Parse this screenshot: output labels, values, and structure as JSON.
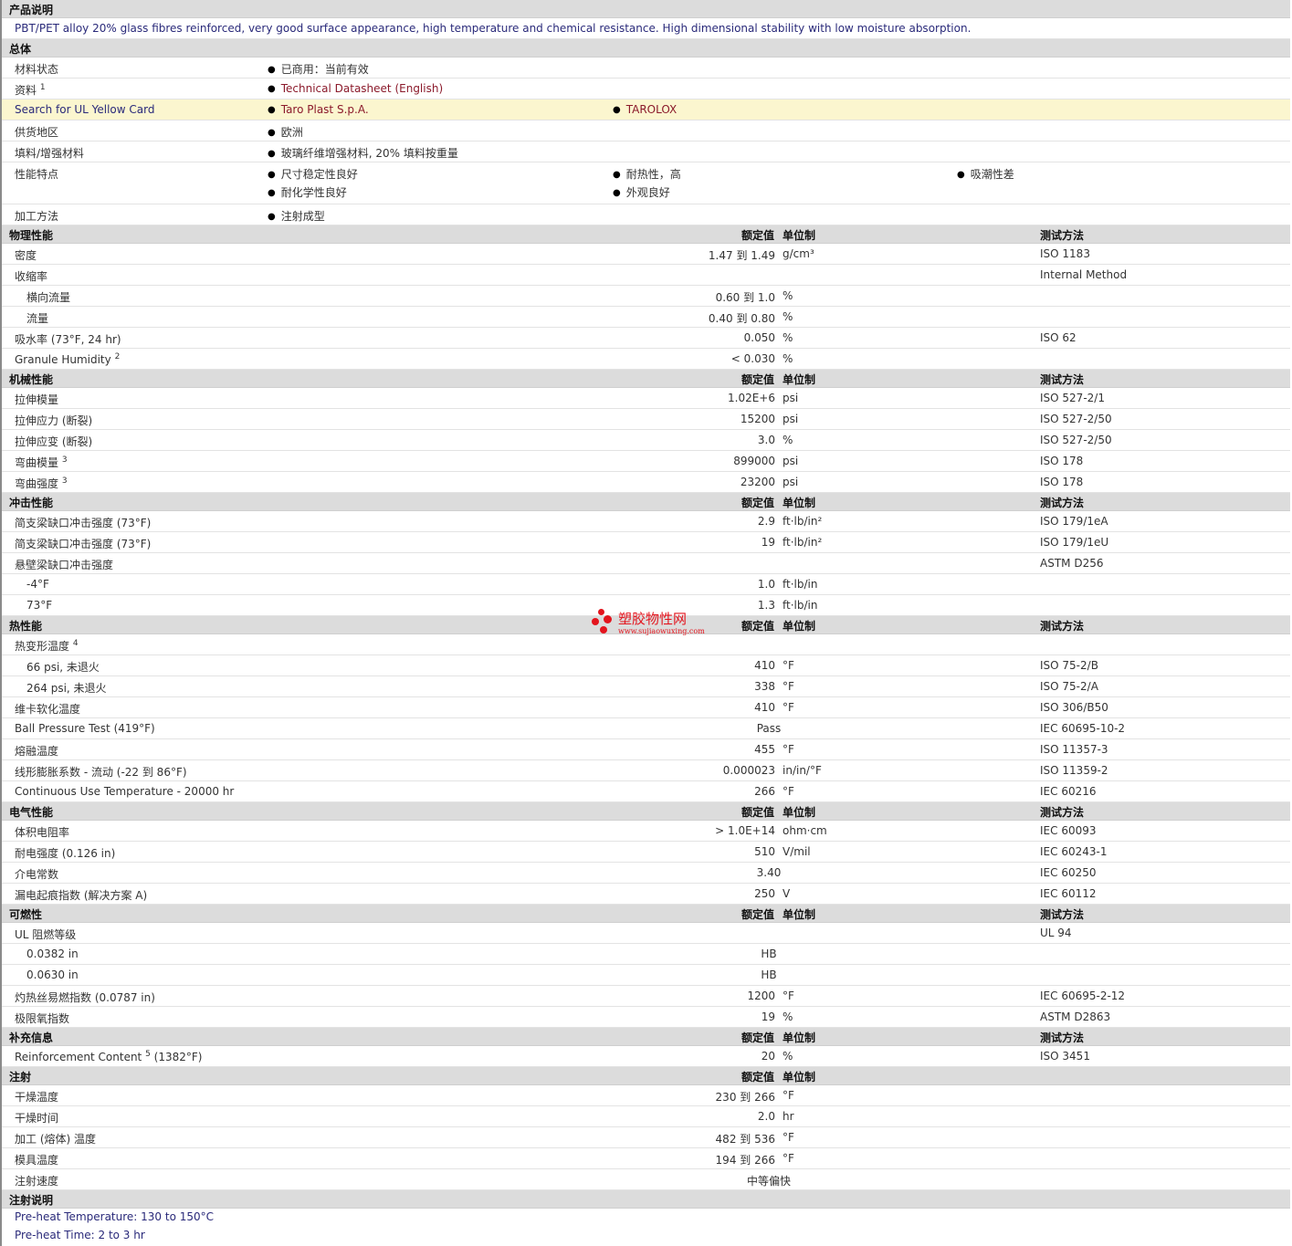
{
  "product_description": {
    "header": "产品说明",
    "text": "PBT/PET alloy 20% glass fibres reinforced, very good surface appearance, high temperature and chemical resistance. High dimensional stability with low moisture absorption."
  },
  "general": {
    "header": "总体",
    "material_status": {
      "label": "材料状态",
      "value": "已商用：当前有效"
    },
    "documents": {
      "label": "资料",
      "sup": "1",
      "link": "Technical Datasheet (English)"
    },
    "ul_search": {
      "label": "Search for UL Yellow Card",
      "supplier": "Taro Plast S.p.A.",
      "brand": "TAROLOX"
    },
    "region": {
      "label": "供货地区",
      "value": "欧洲"
    },
    "filler": {
      "label": "填料/增强材料",
      "value": "玻璃纤维增强材料, 20% 填料按重量"
    },
    "features": {
      "label": "性能特点",
      "items": [
        "尺寸稳定性良好",
        "耐热性，高",
        "吸潮性差",
        "耐化学性良好",
        "外观良好"
      ]
    },
    "processing": {
      "label": "加工方法",
      "value": "注射成型"
    }
  },
  "col_headers": {
    "nominal": "额定值",
    "unit": "单位制",
    "method": "测试方法"
  },
  "sections": {
    "physical": {
      "title": "物理性能",
      "rows": [
        {
          "label": "密度",
          "value": "1.47 到  1.49",
          "unit": "g/cm³",
          "method": "ISO 1183"
        },
        {
          "label": "收缩率",
          "method": "Internal Method"
        },
        {
          "label": "横向流量",
          "value": "0.60 到  1.0",
          "unit": "%"
        },
        {
          "label": "流量",
          "value": "0.40 到  0.80",
          "unit": "%"
        },
        {
          "label": "吸水率 (73°F, 24 hr)",
          "value": "0.050",
          "unit": "%",
          "method": "ISO 62"
        },
        {
          "label": "Granule Humidity",
          "sup": "2",
          "value": "< 0.030",
          "unit": "%"
        }
      ]
    },
    "mechanical": {
      "title": "机械性能",
      "rows": [
        {
          "label": "拉伸模量",
          "value": "1.02E+6",
          "unit": "psi",
          "method": "ISO 527-2/1"
        },
        {
          "label": "拉伸应力 (断裂)",
          "value": "15200",
          "unit": "psi",
          "method": "ISO 527-2/50"
        },
        {
          "label": "拉伸应变 (断裂)",
          "value": "3.0",
          "unit": "%",
          "method": "ISO 527-2/50"
        },
        {
          "label": "弯曲模量",
          "sup": "3",
          "value": "899000",
          "unit": "psi",
          "method": "ISO 178"
        },
        {
          "label": "弯曲强度",
          "sup": "3",
          "value": "23200",
          "unit": "psi",
          "method": "ISO 178"
        }
      ]
    },
    "impact": {
      "title": "冲击性能",
      "rows": [
        {
          "label": "简支梁缺口冲击强度 (73°F)",
          "value": "2.9",
          "unit": "ft·lb/in²",
          "method": "ISO 179/1eA"
        },
        {
          "label": "简支梁缺口冲击强度 (73°F)",
          "value": "19",
          "unit": "ft·lb/in²",
          "method": "ISO 179/1eU"
        },
        {
          "label": "悬壁梁缺口冲击强度",
          "method": "ASTM D256"
        },
        {
          "label": "-4°F",
          "value": "1.0",
          "unit": "ft·lb/in"
        },
        {
          "label": "73°F",
          "value": "1.3",
          "unit": "ft·lb/in"
        }
      ]
    },
    "thermal": {
      "title": "热性能",
      "rows": [
        {
          "label": "热变形温度",
          "sup": "4"
        },
        {
          "label": "66 psi, 未退火",
          "value": "410",
          "unit": "°F",
          "method": "ISO 75-2/B"
        },
        {
          "label": "264 psi, 未退火",
          "value": "338",
          "unit": "°F",
          "method": "ISO 75-2/A"
        },
        {
          "label": "维卡软化温度",
          "value": "410",
          "unit": "°F",
          "method": "ISO 306/B50"
        },
        {
          "label": "Ball Pressure Test (419°F)",
          "value": "Pass",
          "method": "IEC 60695-10-2"
        },
        {
          "label": "熔融温度",
          "value": "455",
          "unit": "°F",
          "method": "ISO 11357-3"
        },
        {
          "label": "线形膨胀系数 - 流动 (-22 到  86°F)",
          "value": "0.000023",
          "unit": "in/in/°F",
          "method": "ISO 11359-2"
        },
        {
          "label": "Continuous Use Temperature - 20000 hr",
          "value": "266",
          "unit": "°F",
          "method": "IEC 60216"
        }
      ]
    },
    "electrical": {
      "title": "电气性能",
      "rows": [
        {
          "label": "体积电阻率",
          "value": "> 1.0E+14",
          "unit": "ohm·cm",
          "method": "IEC 60093"
        },
        {
          "label": "耐电强度 (0.126 in)",
          "value": "510",
          "unit": "V/mil",
          "method": "IEC 60243-1"
        },
        {
          "label": "介电常数",
          "value": "3.40",
          "method": "IEC 60250"
        },
        {
          "label": "漏电起痕指数 (解决方案 A)",
          "value": "250",
          "unit": "V",
          "method": "IEC 60112"
        }
      ]
    },
    "flammability": {
      "title": "可燃性",
      "rows": [
        {
          "label": "UL 阻燃等级",
          "method": "UL 94"
        },
        {
          "label": "0.0382 in",
          "value": "HB"
        },
        {
          "label": "0.0630 in",
          "value": "HB"
        },
        {
          "label": "灼热丝易燃指数 (0.0787 in)",
          "value": "1200",
          "unit": "°F",
          "method": "IEC 60695-2-12"
        },
        {
          "label": "极限氧指数",
          "value": "19",
          "unit": "%",
          "method": "ASTM D2863"
        }
      ]
    },
    "additional": {
      "title": "补充信息",
      "rows": [
        {
          "label": "Reinforcement Content",
          "sup": "5",
          "label2": "(1382°F)",
          "value": "20",
          "unit": "%",
          "method": "ISO 3451"
        }
      ]
    },
    "injection": {
      "title": "注射",
      "rows": [
        {
          "label": "干燥温度",
          "value": "230 到  266",
          "unit": "°F"
        },
        {
          "label": "干燥时间",
          "value": "2.0",
          "unit": "hr"
        },
        {
          "label": "加工 (熔体) 温度",
          "value": "482 到  536",
          "unit": "°F"
        },
        {
          "label": "模具温度",
          "value": "194 到  266",
          "unit": "°F"
        },
        {
          "label": "注射速度",
          "value": "中等偏快"
        }
      ]
    }
  },
  "injection_notes": {
    "title": "注射说明",
    "lines": [
      "Pre-heat Temperature: 130 to 150°C",
      "Pre-heat Time: 2 to 3 hr"
    ]
  },
  "watermark": {
    "title": "塑胶物性网",
    "url": "www.sujiaowuxing.com"
  }
}
